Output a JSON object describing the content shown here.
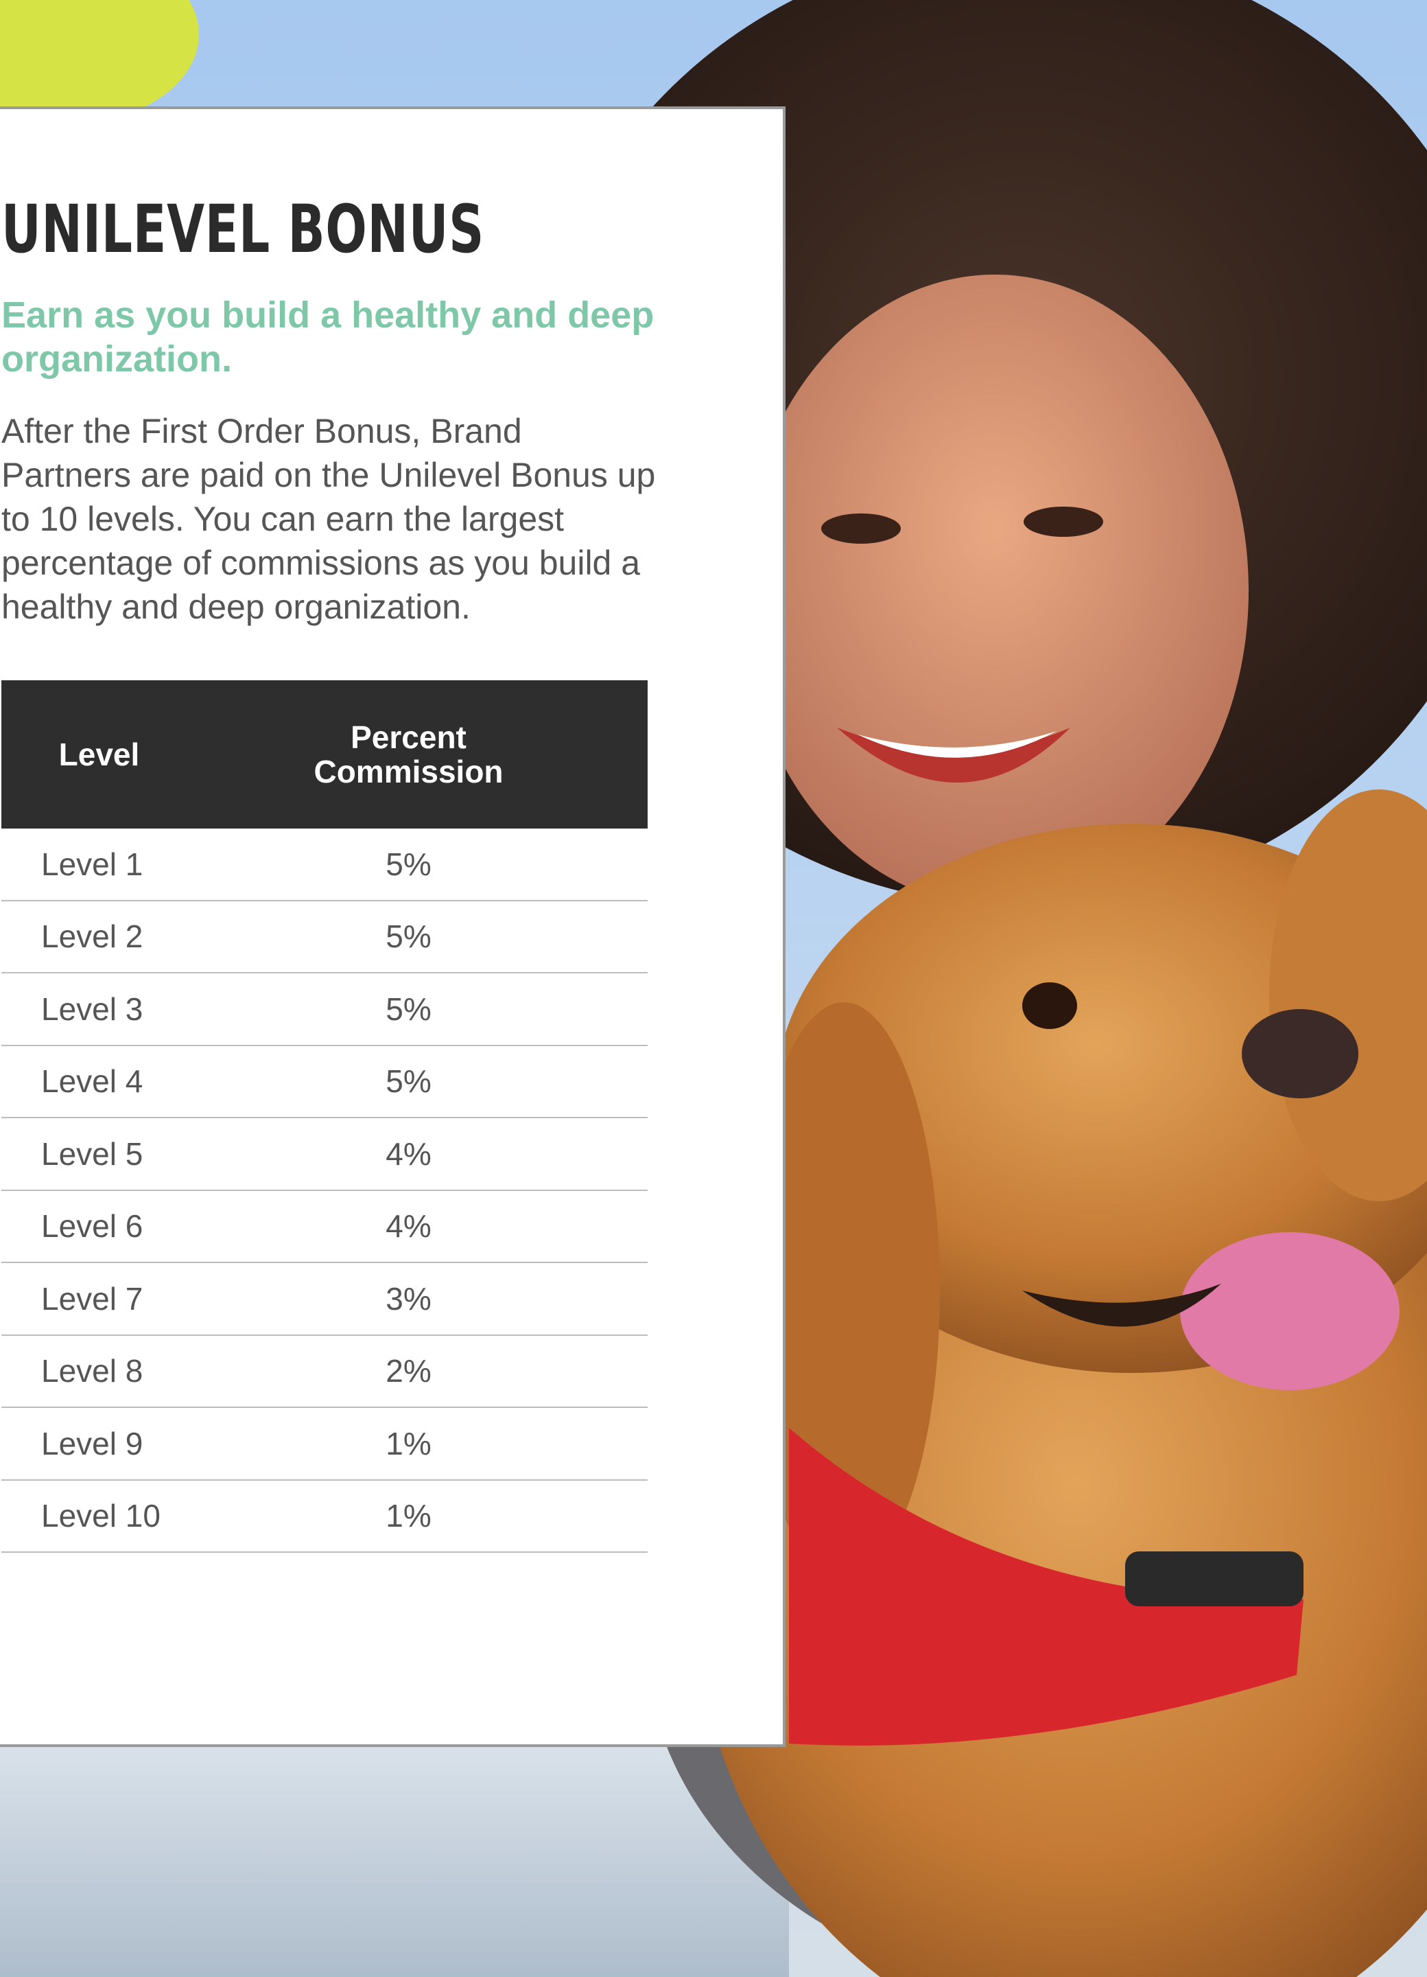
{
  "page": {
    "title": "UNILEVEL BONUS",
    "subtitle": "Earn as you build a healthy and deep organization.",
    "body": "After the First Order Bonus, Brand Partners are paid on the Unilevel Bonus up to 10 levels. You can earn the largest percentage of commissions as you build a healthy and deep organization."
  },
  "table": {
    "headers": {
      "level": "Level",
      "percent_line1": "Percent",
      "percent_line2": "Commission"
    },
    "rows": [
      {
        "level": "Level 1",
        "percent": "5%"
      },
      {
        "level": "Level 2",
        "percent": "5%"
      },
      {
        "level": "Level 3",
        "percent": "5%"
      },
      {
        "level": "Level 4",
        "percent": "5%"
      },
      {
        "level": "Level 5",
        "percent": "4%"
      },
      {
        "level": "Level 6",
        "percent": "4%"
      },
      {
        "level": "Level 7",
        "percent": "3%"
      },
      {
        "level": "Level 8",
        "percent": "2%"
      },
      {
        "level": "Level 9",
        "percent": "1%"
      },
      {
        "level": "Level 10",
        "percent": "1%"
      }
    ]
  },
  "colors": {
    "title": "#2b2b2b",
    "subtitle_accent": "#7ec8a9",
    "body_text": "#555555",
    "table_header_bg": "#2e2e2e",
    "card_border": "#9a9a9a"
  },
  "background_image": {
    "icons": [
      "woman-photo",
      "dog-photo"
    ]
  }
}
